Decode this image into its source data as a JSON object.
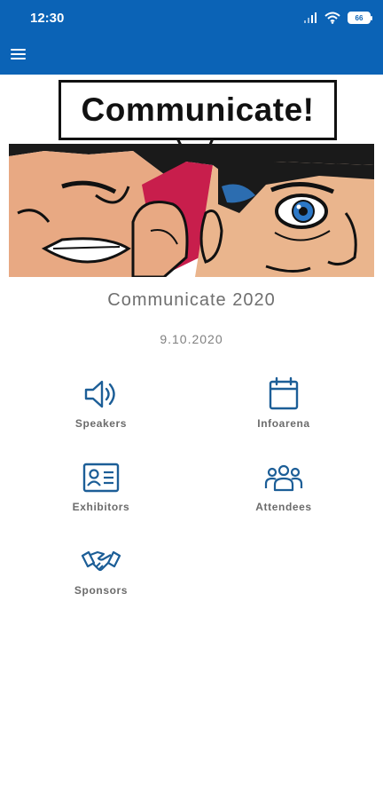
{
  "status_bar": {
    "time": "12:30",
    "battery_level": "66",
    "icons": [
      "signal-icon",
      "wifi-icon",
      "battery-icon"
    ]
  },
  "app_bar": {
    "menu_icon": "hamburger-menu-icon",
    "background_color": "#0b63b6"
  },
  "banner": {
    "title": "Communicate!",
    "image": "comic-whisper-illustration"
  },
  "event": {
    "name": "Communicate 2020",
    "date": "9.10.2020"
  },
  "menu": {
    "items": [
      {
        "label": "Speakers",
        "icon": "speaker-icon"
      },
      {
        "label": "Infoarena",
        "icon": "calendar-icon"
      },
      {
        "label": "Exhibitors",
        "icon": "id-card-icon"
      },
      {
        "label": "Attendees",
        "icon": "group-icon"
      },
      {
        "label": "Sponsors",
        "icon": "handshake-icon"
      }
    ]
  },
  "colors": {
    "primary": "#0b63b6",
    "icon": "#1c5e97",
    "text_muted": "#6f6f6f"
  }
}
